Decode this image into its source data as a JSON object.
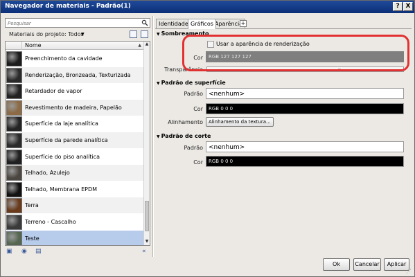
{
  "window": {
    "title": "Navegador de materiais - Padrão(1)",
    "help_label": "?",
    "close_label": "X"
  },
  "search": {
    "placeholder": "Pesquisar"
  },
  "library": {
    "label": "Materiais do projeto: Todos"
  },
  "list": {
    "column_header": "Nome",
    "items": [
      {
        "name": "Preenchimento da cavidade",
        "swatch": "#1c1c1c"
      },
      {
        "name": "Renderização, Bronzeada, Texturizada",
        "swatch": "#2a2a2a"
      },
      {
        "name": "Retardador de vapor",
        "swatch": "#222222"
      },
      {
        "name": "Revestimento de madeira, Papelão",
        "swatch": "#8b6a45"
      },
      {
        "name": "Superfície da laje analítica",
        "swatch": "#242424"
      },
      {
        "name": "Superfície da parede analítica",
        "swatch": "#2b2b2b"
      },
      {
        "name": "Superfície do piso analítica",
        "swatch": "#202020"
      },
      {
        "name": "Telhado, Azulejo",
        "swatch": "#4b4640"
      },
      {
        "name": "Telhado, Membrana EPDM",
        "swatch": "#121212"
      },
      {
        "name": "Terra",
        "swatch": "#6a3a1a"
      },
      {
        "name": "Terreno - Cascalho",
        "swatch": "#3a3a3a"
      },
      {
        "name": "Teste",
        "swatch": "#556650"
      }
    ],
    "selected_index": 11
  },
  "tabs": [
    {
      "label": "Identidade"
    },
    {
      "label": "Gráficos"
    },
    {
      "label": "Aparência"
    }
  ],
  "tab_add_label": "+",
  "shading": {
    "title": "Sombreamento",
    "checkbox_label": "Usar a aparência de renderização",
    "color_label": "Cor",
    "color_value": "RGB 127 127 127",
    "transparency_label": "Transparência"
  },
  "surface": {
    "title": "Padrão de superfície",
    "pattern_label": "Padrão",
    "pattern_value": "<nenhum>",
    "color_label": "Cor",
    "color_value": "RGB 0 0 0",
    "alignment_label": "Alinhamento",
    "alignment_button": "Alinhamento da textura..."
  },
  "cut": {
    "title": "Padrão de corte",
    "pattern_label": "Padrão",
    "pattern_value": "<nenhum>",
    "color_label": "Cor",
    "color_value": "RGB 0 0 0"
  },
  "footer": {
    "ok": "Ok",
    "cancel": "Cancelar",
    "apply": "Aplicar"
  },
  "colors": {
    "title_bar": "#1f4a99",
    "selected_row": "#b7cbeb",
    "highlight": "#e23131"
  }
}
